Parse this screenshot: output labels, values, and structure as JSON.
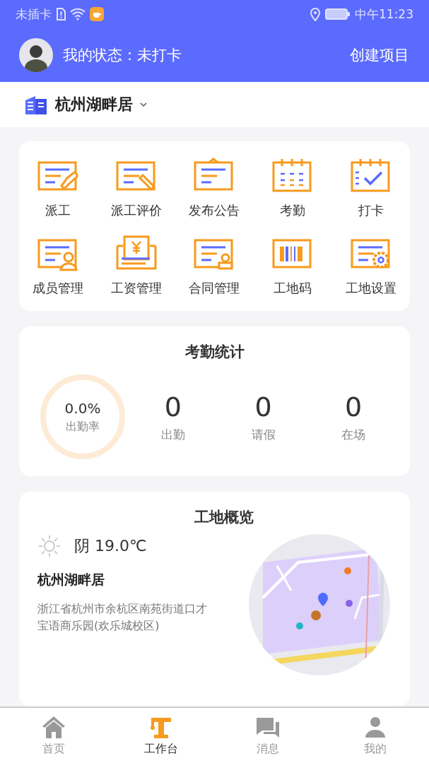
{
  "status_bar": {
    "carrier": "未插卡",
    "time": "中午11:23"
  },
  "header": {
    "status": "我的状态：未打卡",
    "action": "创建项目"
  },
  "project": {
    "name": "杭州湖畔居"
  },
  "tools": [
    {
      "label": "派工"
    },
    {
      "label": "派工评价"
    },
    {
      "label": "发布公告"
    },
    {
      "label": "考勤"
    },
    {
      "label": "打卡"
    },
    {
      "label": "成员管理"
    },
    {
      "label": "工资管理"
    },
    {
      "label": "合同管理"
    },
    {
      "label": "工地码"
    },
    {
      "label": "工地设置"
    }
  ],
  "attendance": {
    "title": "考勤统计",
    "rate": "0.0%",
    "rate_label": "出勤率",
    "level": 0,
    "stats": [
      {
        "value": "0",
        "label": "出勤"
      },
      {
        "value": "0",
        "label": "请假"
      },
      {
        "value": "0",
        "label": "在场"
      }
    ]
  },
  "overview": {
    "title": "工地概览",
    "weather": "阴 19.0℃",
    "site": "杭州湖畔居",
    "address": "浙江省杭州市余杭区南苑街道口才宝语商乐园(欢乐城校区)"
  },
  "nav": [
    {
      "label": "首页",
      "selected": false
    },
    {
      "label": "工作台",
      "selected": true
    },
    {
      "label": "消息",
      "selected": false
    },
    {
      "label": "我的",
      "selected": false
    }
  ]
}
